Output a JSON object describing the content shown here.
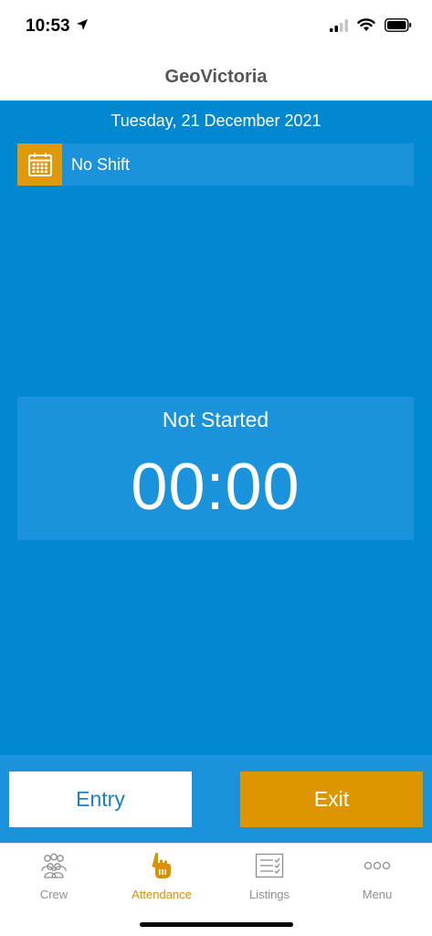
{
  "status_bar": {
    "time": "10:53",
    "icons": [
      "location-arrow-icon",
      "cellular-signal-icon",
      "wifi-icon",
      "battery-icon"
    ]
  },
  "header": {
    "title": "GeoVictoria"
  },
  "main": {
    "date": "Tuesday, 21 December 2021",
    "shift": {
      "icon": "calendar-icon",
      "label": "No Shift"
    },
    "timer": {
      "status": "Not Started",
      "value": "00:00"
    }
  },
  "actions": {
    "entry_label": "Entry",
    "exit_label": "Exit"
  },
  "tabs": [
    {
      "label": "Crew",
      "icon": "crew-icon",
      "active": false
    },
    {
      "label": "Attendance",
      "icon": "hand-pointer-icon",
      "active": true
    },
    {
      "label": "Listings",
      "icon": "checklist-icon",
      "active": false
    },
    {
      "label": "Menu",
      "icon": "more-dots-icon",
      "active": false
    }
  ],
  "colors": {
    "primary_blue": "#0288d1",
    "panel_blue": "#1a93dc",
    "accent_orange": "#dd9500",
    "active_tab": "#d99100",
    "inactive_tab": "#8e8e8e"
  }
}
